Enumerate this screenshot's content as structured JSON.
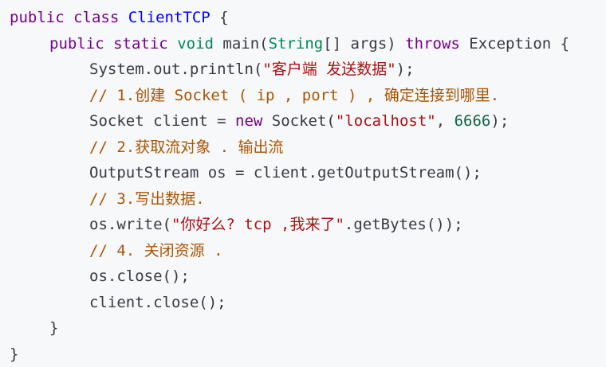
{
  "code": {
    "lines": [
      {
        "indent": 0,
        "tokens": [
          {
            "t": "public",
            "c": "kw"
          },
          {
            "t": " ",
            "c": "plain"
          },
          {
            "t": "class",
            "c": "kw"
          },
          {
            "t": " ",
            "c": "plain"
          },
          {
            "t": "ClientTCP",
            "c": "cls-name"
          },
          {
            "t": " {",
            "c": "plain"
          }
        ]
      },
      {
        "indent": 1,
        "tokens": [
          {
            "t": "public",
            "c": "kw"
          },
          {
            "t": " ",
            "c": "plain"
          },
          {
            "t": "static",
            "c": "kw"
          },
          {
            "t": " ",
            "c": "plain"
          },
          {
            "t": "void",
            "c": "type-name"
          },
          {
            "t": " main(",
            "c": "plain"
          },
          {
            "t": "String",
            "c": "type-name"
          },
          {
            "t": "[] args) ",
            "c": "plain"
          },
          {
            "t": "throws",
            "c": "kw"
          },
          {
            "t": " Exception {",
            "c": "plain"
          }
        ]
      },
      {
        "indent": 2,
        "tokens": [
          {
            "t": "System.out.println(",
            "c": "plain"
          },
          {
            "t": "\"客户端 发送数据\"",
            "c": "str"
          },
          {
            "t": ");",
            "c": "plain"
          }
        ]
      },
      {
        "indent": 2,
        "tokens": [
          {
            "t": "// 1.创建 Socket ( ip , port ) , 确定连接到哪里.",
            "c": "cmt"
          }
        ]
      },
      {
        "indent": 2,
        "tokens": [
          {
            "t": "Socket client = ",
            "c": "plain"
          },
          {
            "t": "new",
            "c": "kw"
          },
          {
            "t": " Socket(",
            "c": "plain"
          },
          {
            "t": "\"localhost\"",
            "c": "str"
          },
          {
            "t": ", ",
            "c": "plain"
          },
          {
            "t": "6666",
            "c": "num"
          },
          {
            "t": ");",
            "c": "plain"
          }
        ]
      },
      {
        "indent": 2,
        "tokens": [
          {
            "t": "// 2.获取流对象 . 输出流",
            "c": "cmt"
          }
        ]
      },
      {
        "indent": 2,
        "tokens": [
          {
            "t": "OutputStream os = client.getOutputStream();",
            "c": "plain"
          }
        ]
      },
      {
        "indent": 2,
        "tokens": [
          {
            "t": "// 3.写出数据.",
            "c": "cmt"
          }
        ]
      },
      {
        "indent": 2,
        "tokens": [
          {
            "t": "os.write(",
            "c": "plain"
          },
          {
            "t": "\"你好么? tcp ,我来了\"",
            "c": "str"
          },
          {
            "t": ".getBytes());",
            "c": "plain"
          }
        ]
      },
      {
        "indent": 2,
        "tokens": [
          {
            "t": "// 4. 关闭资源 .",
            "c": "cmt"
          }
        ]
      },
      {
        "indent": 2,
        "tokens": [
          {
            "t": "os.close();",
            "c": "plain"
          }
        ]
      },
      {
        "indent": 2,
        "tokens": [
          {
            "t": "client.close();",
            "c": "plain"
          }
        ]
      },
      {
        "indent": 1,
        "tokens": [
          {
            "t": "}",
            "c": "plain"
          }
        ]
      },
      {
        "indent": 0,
        "tokens": [
          {
            "t": "}",
            "c": "plain"
          }
        ]
      }
    ]
  },
  "colors": {
    "background": "#f6f8fa",
    "keyword": "#770088",
    "type": "#008855",
    "string": "#aa1111",
    "comment": "#aa5500",
    "number": "#116644",
    "class_name": "#0000ff",
    "plain": "#383a42"
  }
}
